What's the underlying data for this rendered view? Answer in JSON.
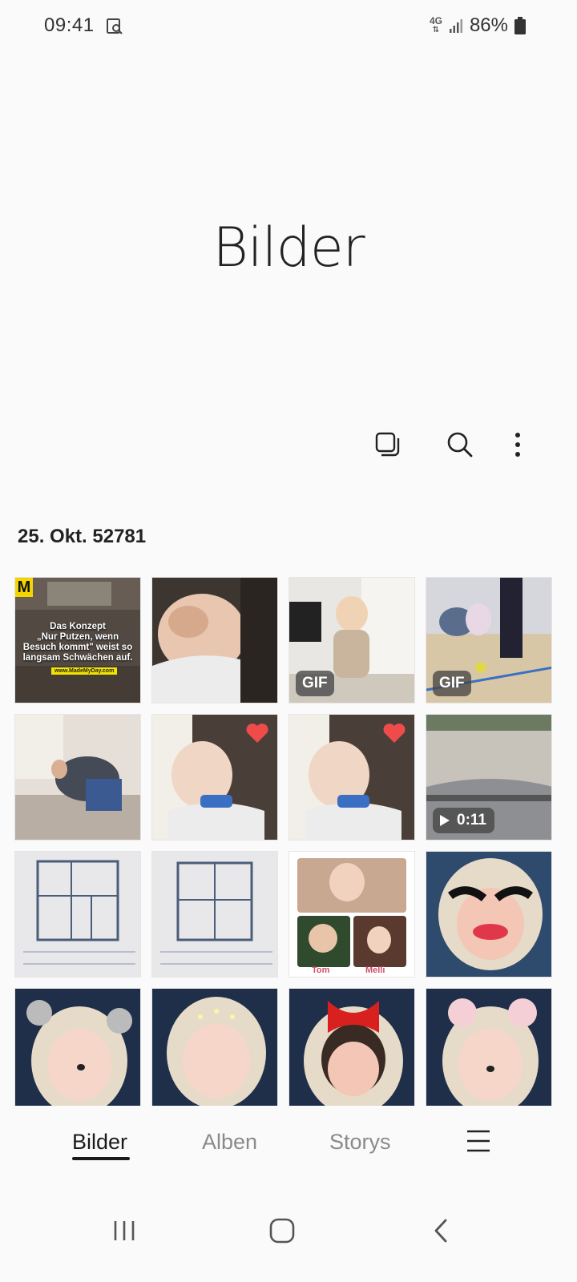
{
  "status_bar": {
    "time": "09:41",
    "network_top": "4G",
    "battery": "86%",
    "icons": [
      "screenshot-search-icon",
      "signal-icon",
      "battery-icon"
    ]
  },
  "header": {
    "title": "Bilder"
  },
  "toolbar": {
    "icons": [
      "select-icon",
      "search-icon",
      "more-options-icon"
    ]
  },
  "gallery": {
    "date_label": "25. Okt. 52781",
    "meme": {
      "logo": "M",
      "text_line1": "Das Konzept",
      "text_line2": "„Nur Putzen, wenn",
      "text_line3": "Besuch kommt\" weist so",
      "text_line4": "langsam Schwächen auf.",
      "link": "www.MadeMyDay.com"
    },
    "badges": {
      "gif_1": "GIF",
      "gif_2": "GIF",
      "video_duration": "0:11"
    },
    "collage": {
      "label_left": "Tom",
      "label_right": "Melli"
    }
  },
  "bottom_tabs": {
    "tab_pictures": "Bilder",
    "tab_albums": "Alben",
    "tab_stories": "Storys",
    "active": "Bilder"
  },
  "nav": {
    "recents": "recents-icon",
    "home": "home-icon",
    "back": "back-icon"
  },
  "colors": {
    "background": "#fafafa",
    "text": "#1a1a1a",
    "inactive_tab": "#8a8a8a",
    "favorite": "#ef4b4b"
  }
}
